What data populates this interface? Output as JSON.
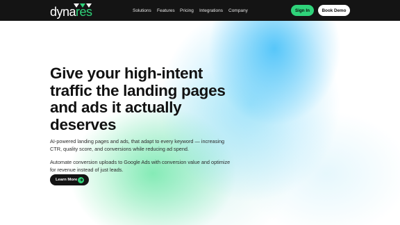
{
  "brand": {
    "logo_text_main": "dyna",
    "logo_text_accent": "res",
    "accent_color": "#2fd37a",
    "nav_bg": "#141414"
  },
  "nav": {
    "links": [
      "Solutions",
      "Features",
      "Pricing",
      "Integrations",
      "Company"
    ],
    "signin_label": "Sign In",
    "demo_label": "Book Demo"
  },
  "hero": {
    "title": "Give your high-intent traffic the landing pages and ads it actually deserves",
    "paragraph1": "AI-powered landing pages and ads, that adapt to every keyword — increasing CTR, quality score, and conversions while reducing ad spend.",
    "paragraph2": "Automate conversion uploads to Google Ads with conversion value and optimize for revenue instead of just leads.",
    "cta_label": "Learn More",
    "cta_icon": "arrow-right-icon"
  }
}
